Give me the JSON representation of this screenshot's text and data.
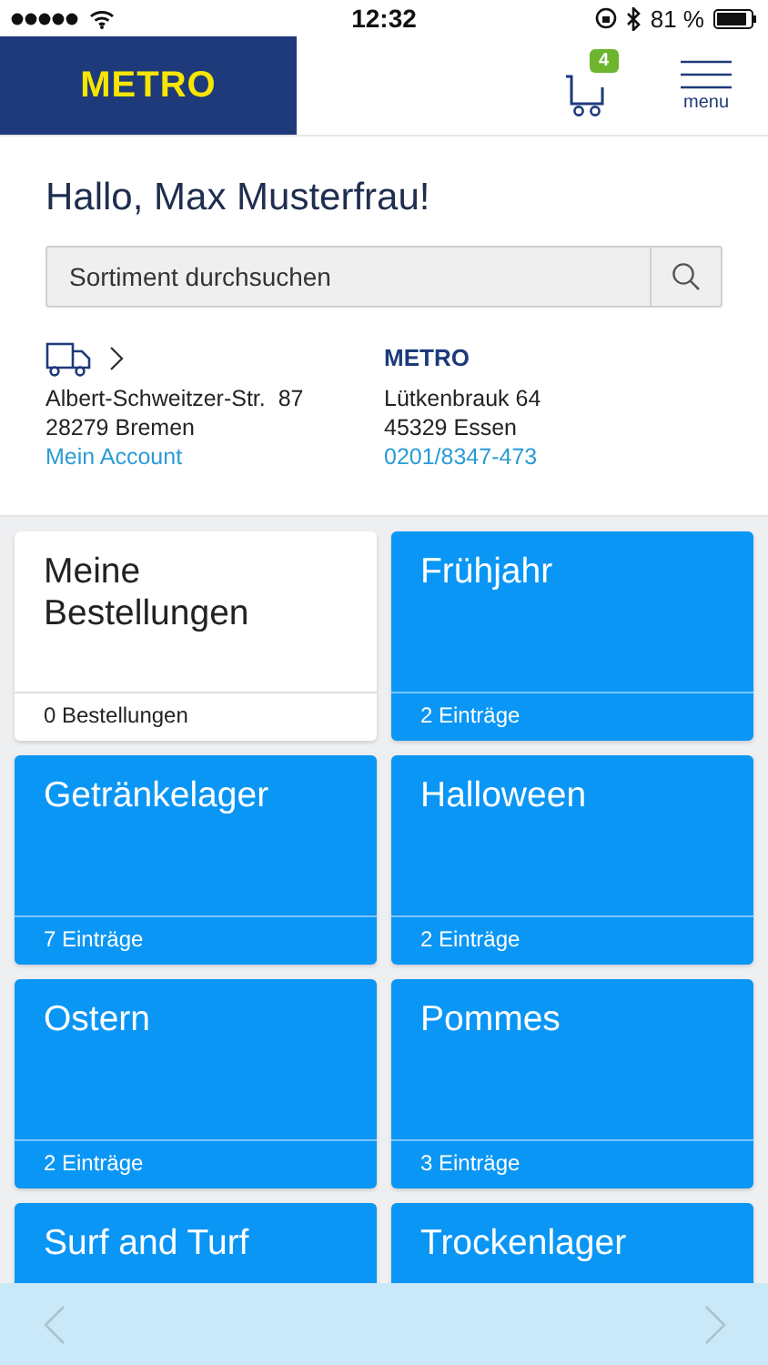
{
  "status_bar": {
    "time": "12:32",
    "battery": "81 %"
  },
  "header": {
    "logo": "METRO",
    "cart_count": "4",
    "menu_label": "menu"
  },
  "greeting": "Hallo, Max Musterfrau!",
  "search": {
    "placeholder": "Sortiment durchsuchen"
  },
  "delivery": {
    "street": "Albert-Schweitzer-Str.  87",
    "city": "28279 Bremen",
    "link": "Mein Account"
  },
  "store": {
    "logo": "METRO",
    "street": "Lütkenbrauk 64",
    "city": "45329 Essen",
    "phone": "0201/8347-473"
  },
  "tiles": [
    {
      "kind": "orders",
      "title": "Meine Bestellungen",
      "count": "0 Bestellungen"
    },
    {
      "kind": "list",
      "title": "Frühjahr",
      "count": "2 Einträge"
    },
    {
      "kind": "list",
      "title": "Getränkelager",
      "count": "7 Einträge"
    },
    {
      "kind": "list",
      "title": "Halloween",
      "count": "2 Einträge"
    },
    {
      "kind": "list",
      "title": "Ostern",
      "count": "2 Einträge"
    },
    {
      "kind": "list",
      "title": "Pommes",
      "count": "3 Einträge"
    },
    {
      "kind": "list",
      "title": "Surf and Turf"
    },
    {
      "kind": "list",
      "title": "Trockenlager"
    }
  ],
  "toolbar": {
    "back_disabled": true,
    "forward_disabled": true
  }
}
